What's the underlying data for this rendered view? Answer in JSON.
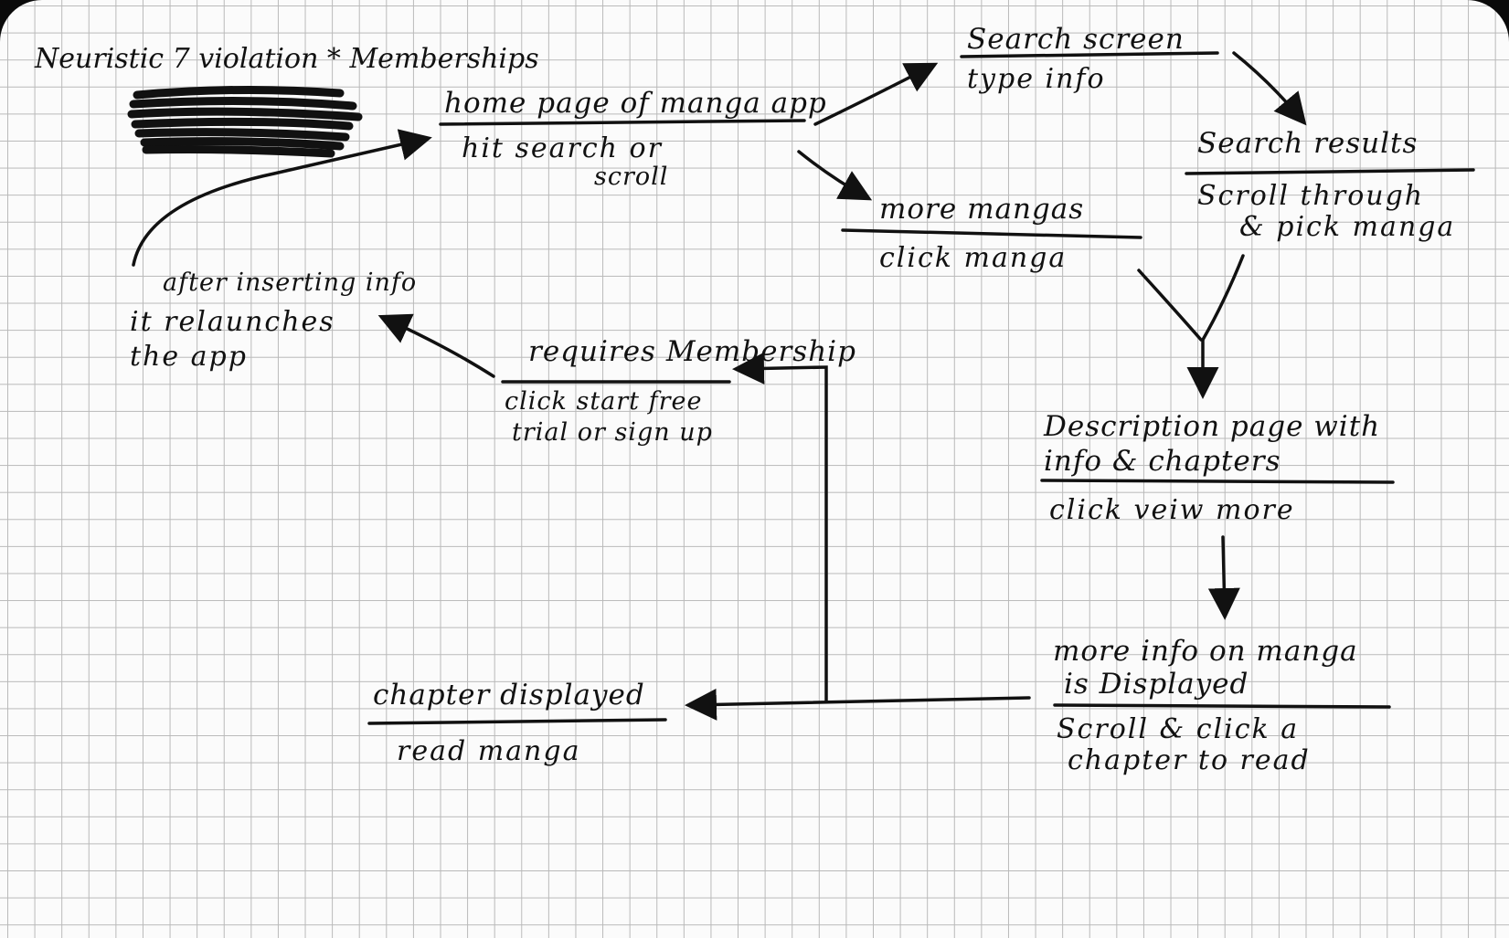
{
  "title": "Neuristic 7 violation * Memberships",
  "nodes": {
    "home": {
      "title": "home page of manga app",
      "action": "hit search or",
      "action2": "scroll"
    },
    "search": {
      "title": "Search screen",
      "action": "type info"
    },
    "results": {
      "title": "Search results",
      "action": "Scroll through",
      "action2": "& pick manga"
    },
    "more_mangas": {
      "title": "more mangas",
      "action": "click manga"
    },
    "description": {
      "title": "Description page with",
      "title2": "info & chapters",
      "action": "click veiw more"
    },
    "more_info": {
      "title": "more info on manga",
      "title2": "is Displayed",
      "action": "Scroll & click a",
      "action2": "chapter to read"
    },
    "chapter": {
      "title": "chapter displayed",
      "action": "read manga"
    },
    "membership": {
      "title": "requires Membership",
      "action": "click start free",
      "action2": "trial or sign up"
    },
    "relaunch": {
      "line1": "after inserting info",
      "line2": "it relaunches",
      "line3": "the app"
    }
  },
  "colors": {
    "ink": "#111111",
    "grid": "#b9b9b9",
    "paper": "#fbfbfb"
  }
}
